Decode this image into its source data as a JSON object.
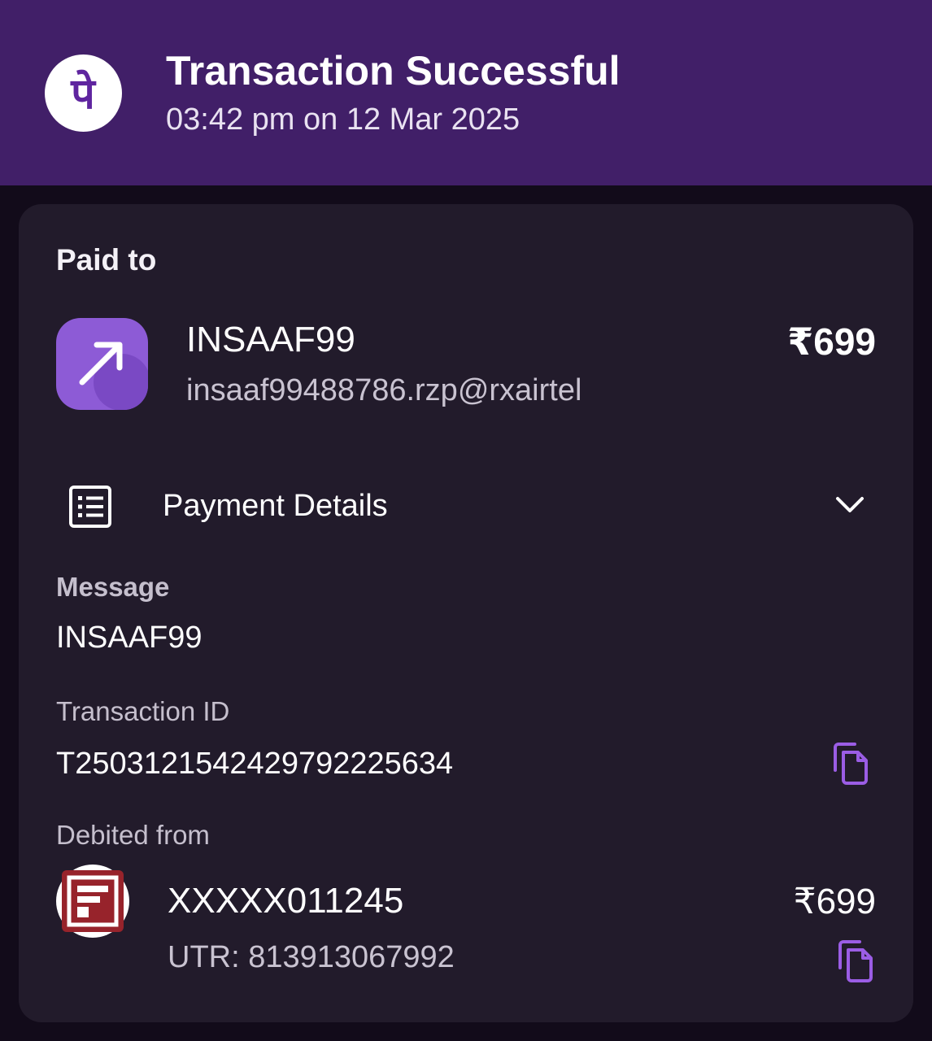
{
  "header": {
    "title": "Transaction Successful",
    "datetime": "03:42 pm on 12 Mar 2025",
    "logo_text": "पे",
    "background": "#411f68"
  },
  "paid_to": {
    "label": "Paid to",
    "name": "INSAAF99",
    "upi_id": "insaaf99488786.rzp@rxairtel",
    "amount": "₹699",
    "icon": "arrow-up-right-icon"
  },
  "payment_details": {
    "label": "Payment Details",
    "icon": "receipt-list-icon",
    "toggle_icon": "chevron-down-icon",
    "message_label": "Message",
    "message_value": "INSAAF99",
    "transaction_id_label": "Transaction ID",
    "transaction_id": "T2503121542429792225634"
  },
  "debited_from": {
    "label": "Debited from",
    "account": "XXXXX011245",
    "utr": "UTR: 813913067992",
    "amount": "₹699",
    "bank_logo": "bank-logo-icon"
  },
  "colors": {
    "accent": "#9b5de5",
    "card": "#221b2b",
    "page": "#120b1a"
  }
}
